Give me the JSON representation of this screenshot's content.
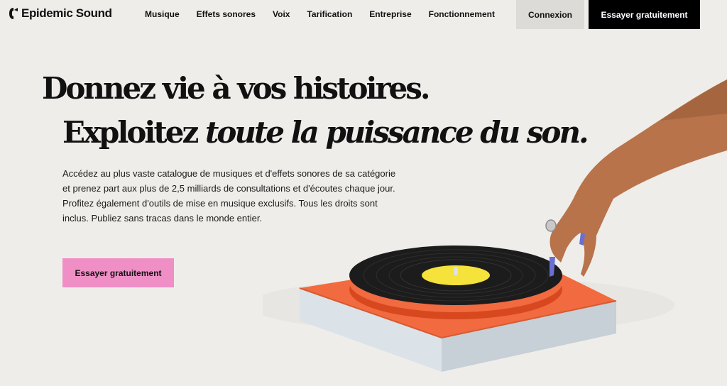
{
  "header": {
    "logo_text": "Epidemic Sound",
    "nav": [
      "Musique",
      "Effets sonores",
      "Voix",
      "Tarification",
      "Entreprise",
      "Fonctionnement"
    ],
    "login_label": "Connexion",
    "try_label": "Essayer gratuitement"
  },
  "hero": {
    "headline_line1": "Donnez vie à vos histoires.",
    "headline_line2_plain": "Exploitez ",
    "headline_line2_italic": "toute la puissance du son.",
    "description": "Accédez au plus vaste catalogue de musiques et d'effets sonores de sa catégorie et prenez part aux plus de 2,5 milliards de consultations et d'écoutes chaque jour. Profitez également d'outils de mise en musique exclusifs. Tous les droits sont inclus. Publiez sans tracas dans le monde entier.",
    "cta_label": "Essayer gratuitement"
  },
  "colors": {
    "background": "#efedea",
    "cta_pink": "#ef8fc6",
    "login_bg": "#dcdbd8",
    "turntable_platter": "#f26a3f",
    "record_label": "#f5e23a"
  },
  "icons": {
    "logo": "epidemic-sound-logo-icon"
  }
}
